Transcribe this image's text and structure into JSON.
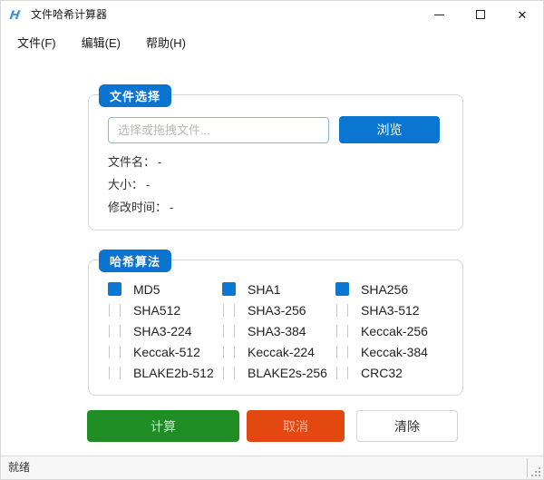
{
  "window": {
    "title": "文件哈希计算器",
    "icons": {
      "app": "hash-app-icon",
      "minimize": "—",
      "maximize": "□",
      "close": "✕"
    }
  },
  "menu": {
    "items": [
      {
        "label": "文件(F)"
      },
      {
        "label": "编辑(E)"
      },
      {
        "label": "帮助(H)"
      }
    ]
  },
  "file_section": {
    "title": "文件选择",
    "input_placeholder": "选择或拖拽文件...",
    "input_value": "",
    "browse_label": "浏览",
    "info": [
      {
        "label": "文件名：",
        "value": "-"
      },
      {
        "label": "大小：",
        "value": "-"
      },
      {
        "label": "修改时间：",
        "value": "-"
      }
    ]
  },
  "hash_section": {
    "title": "哈希算法",
    "algorithms": [
      {
        "label": "MD5",
        "checked": true
      },
      {
        "label": "SHA1",
        "checked": true
      },
      {
        "label": "SHA256",
        "checked": true
      },
      {
        "label": "SHA512",
        "checked": false
      },
      {
        "label": "SHA3-256",
        "checked": false
      },
      {
        "label": "SHA3-512",
        "checked": false
      },
      {
        "label": "SHA3-224",
        "checked": false
      },
      {
        "label": "SHA3-384",
        "checked": false
      },
      {
        "label": "Keccak-256",
        "checked": false
      },
      {
        "label": "Keccak-512",
        "checked": false
      },
      {
        "label": "Keccak-224",
        "checked": false
      },
      {
        "label": "Keccak-384",
        "checked": false
      },
      {
        "label": "BLAKE2b-512",
        "checked": false
      },
      {
        "label": "BLAKE2s-256",
        "checked": false
      },
      {
        "label": "CRC32",
        "checked": false
      }
    ]
  },
  "actions": {
    "calculate_label": "计算",
    "cancel_label": "取消",
    "clear_label": "清除"
  },
  "status_bar": {
    "text": "就绪"
  },
  "colors": {
    "accent": "#0b74d1",
    "green": "#1e8e24",
    "red": "#e2480f"
  }
}
